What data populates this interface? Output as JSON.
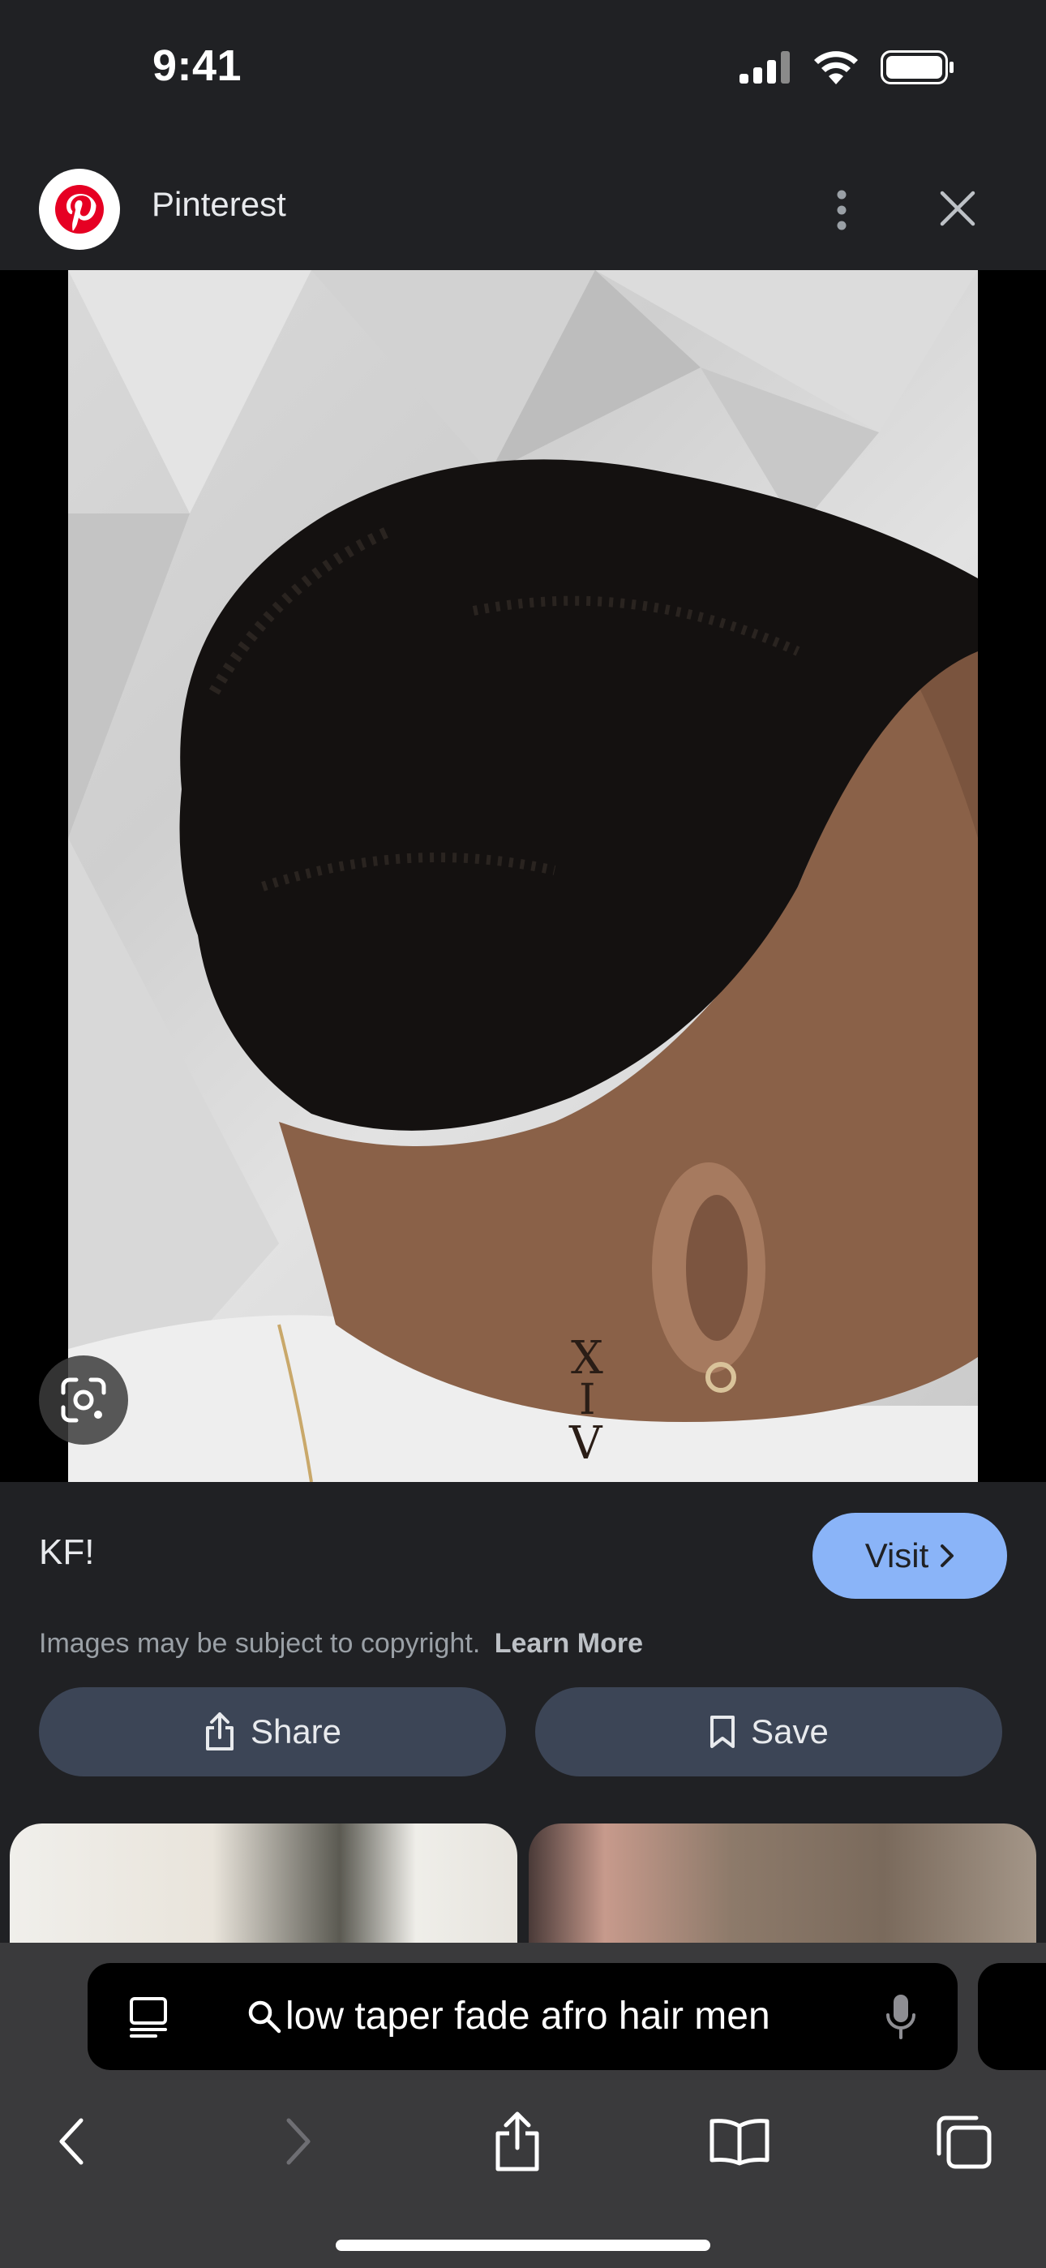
{
  "status_bar": {
    "time": "9:41"
  },
  "source": {
    "name": "Pinterest"
  },
  "image": {
    "alt": "Low taper fade afro hairstyle with neck tattoo"
  },
  "info": {
    "title": "KF!",
    "visit_label": "Visit",
    "copyright_text": "Images may be subject to copyright.",
    "learn_more": "Learn More",
    "share_label": "Share",
    "save_label": "Save"
  },
  "browser": {
    "search_query": "low taper fade afro hair men"
  },
  "colors": {
    "accent": "#8ab4f8",
    "panel_bg": "#202124",
    "button_bg": "#3c4556",
    "toolbar_bg": "#3a3a3c"
  }
}
